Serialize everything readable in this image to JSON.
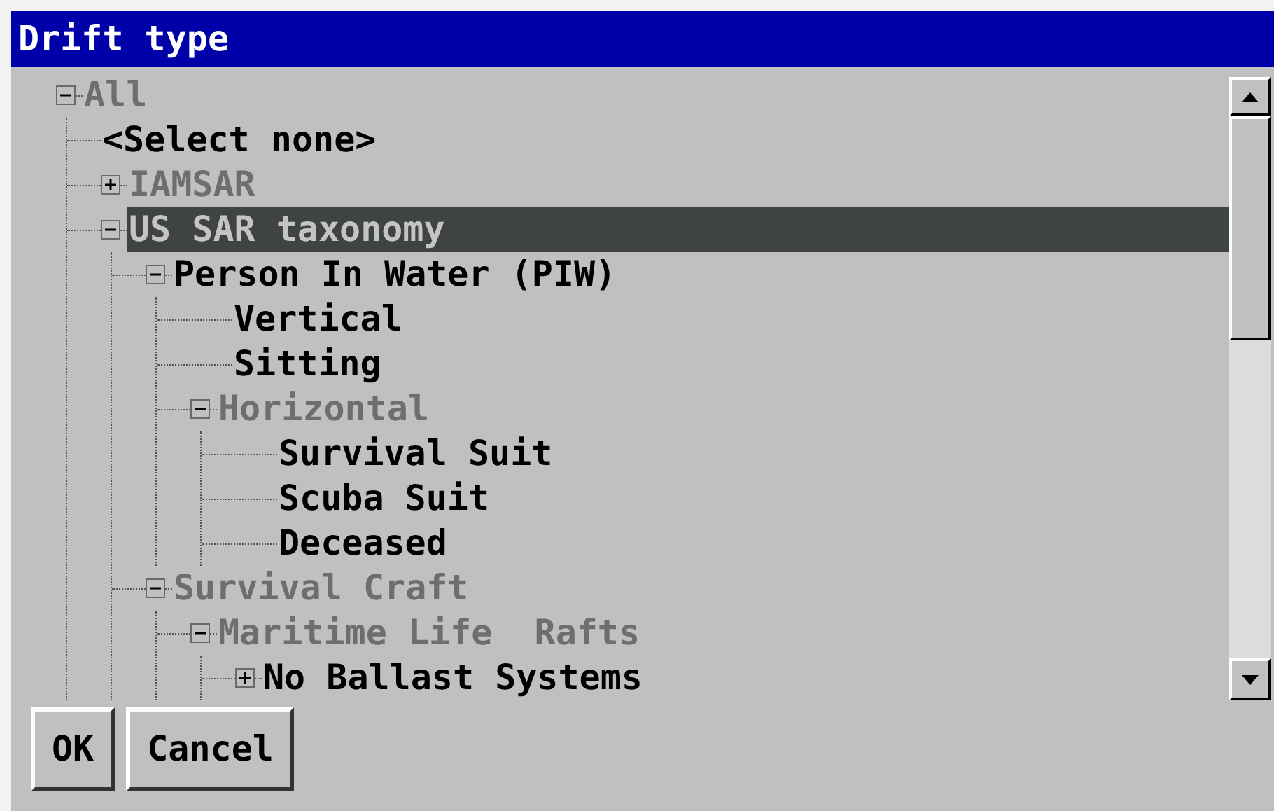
{
  "window": {
    "title": "Drift type"
  },
  "tree": [
    {
      "label": "All",
      "kind": "branch",
      "expanded": true,
      "greyed": true,
      "selected": false,
      "children": [
        {
          "label": "<Select none>",
          "kind": "leaf",
          "greyed": false,
          "selected": false
        },
        {
          "label": "IAMSAR",
          "kind": "branch",
          "expanded": false,
          "greyed": true,
          "selected": false
        },
        {
          "label": "US SAR taxonomy",
          "kind": "branch",
          "expanded": true,
          "greyed": true,
          "selected": true,
          "children": [
            {
              "label": "Person In Water (PIW)",
              "kind": "branch",
              "expanded": true,
              "greyed": false,
              "selected": false,
              "children": [
                {
                  "label": "Vertical",
                  "kind": "leaf",
                  "greyed": false,
                  "selected": false
                },
                {
                  "label": "Sitting",
                  "kind": "leaf",
                  "greyed": false,
                  "selected": false
                },
                {
                  "label": "Horizontal",
                  "kind": "branch",
                  "expanded": true,
                  "greyed": true,
                  "selected": false,
                  "children": [
                    {
                      "label": "Survival Suit",
                      "kind": "leaf",
                      "greyed": false,
                      "selected": false
                    },
                    {
                      "label": "Scuba Suit",
                      "kind": "leaf",
                      "greyed": false,
                      "selected": false
                    },
                    {
                      "label": "Deceased",
                      "kind": "leaf",
                      "greyed": false,
                      "selected": false
                    }
                  ]
                }
              ]
            },
            {
              "label": "Survival Craft",
              "kind": "branch",
              "expanded": true,
              "greyed": true,
              "selected": false,
              "children": [
                {
                  "label": "Maritime Life  Rafts",
                  "kind": "branch",
                  "expanded": true,
                  "greyed": true,
                  "selected": false,
                  "children": [
                    {
                      "label": "No Ballast Systems",
                      "kind": "branch",
                      "expanded": false,
                      "greyed": false,
                      "selected": false
                    }
                  ]
                }
              ]
            }
          ]
        }
      ]
    }
  ],
  "buttons": [
    {
      "label": "OK"
    },
    {
      "label": "Cancel"
    }
  ]
}
